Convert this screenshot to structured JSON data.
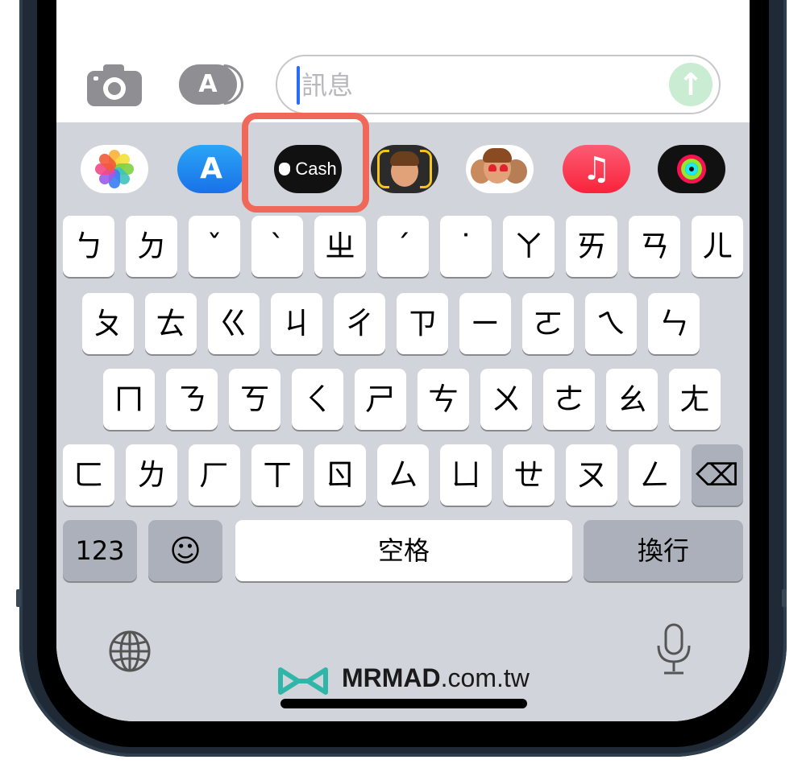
{
  "message_field": {
    "placeholder": "訊息"
  },
  "app_drawer": {
    "apps": [
      {
        "name": "Photos"
      },
      {
        "name": "App Store"
      },
      {
        "name": "Apple Cash",
        "label": "Cash"
      },
      {
        "name": "Memoji"
      },
      {
        "name": "Memoji Stickers"
      },
      {
        "name": "Music"
      },
      {
        "name": "Activity"
      }
    ],
    "highlighted": "Apple Cash"
  },
  "keyboard": {
    "row1": [
      "ㄅ",
      "ㄉ",
      "ˇ",
      "ˋ",
      "ㄓ",
      "ˊ",
      "˙",
      "ㄚ",
      "ㄞ",
      "ㄢ",
      "ㄦ"
    ],
    "row2": [
      "ㄆ",
      "ㄊ",
      "ㄍ",
      "ㄐ",
      "ㄔ",
      "ㄗ",
      "ㄧ",
      "ㄛ",
      "ㄟ",
      "ㄣ"
    ],
    "row3": [
      "ㄇ",
      "ㄋ",
      "ㄎ",
      "ㄑ",
      "ㄕ",
      "ㄘ",
      "ㄨ",
      "ㄜ",
      "ㄠ",
      "ㄤ"
    ],
    "row4": [
      "ㄈ",
      "ㄌ",
      "ㄏ",
      "ㄒ",
      "ㄖ",
      "ㄙ",
      "ㄩ",
      "ㄝ",
      "ㄡ",
      "ㄥ"
    ],
    "delete_symbol": "⌫",
    "numbers_label": "123",
    "emoji_symbol": "☺",
    "space_label": "空格",
    "return_label": "換行"
  },
  "watermark": {
    "brand": "MRMAD",
    "domain": ".com.tw"
  },
  "colors": {
    "accent_highlight": "#f0685a",
    "send_button": "#c9ecd3",
    "keyboard_bg": "#d1d4da"
  }
}
